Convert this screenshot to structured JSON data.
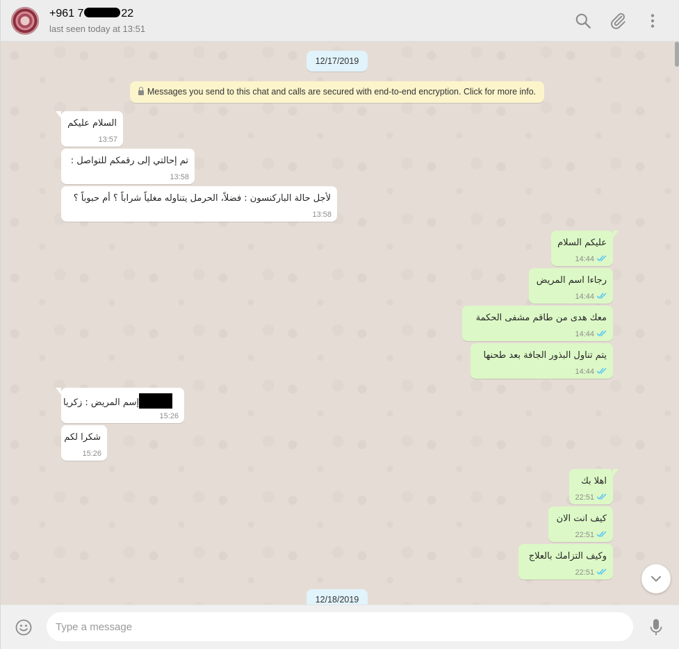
{
  "header": {
    "contact_prefix": "+961 7",
    "contact_suffix": "22",
    "last_seen": "last seen today at 13:51",
    "icons": [
      "search-icon",
      "attach-icon",
      "menu-icon"
    ]
  },
  "chat": {
    "date_1": "12/17/2019",
    "encryption_notice": "Messages you send to this chat and calls are secured with end-to-end encryption. Click for more info.",
    "messages": [
      {
        "dir": "in",
        "text": "السلام عليكم",
        "time": "13:57"
      },
      {
        "dir": "in",
        "text": "تم إحالتي إلى رقمكم للتواصل :",
        "time": "13:58"
      },
      {
        "dir": "in",
        "text": "لأجل حالة الباركنسون : فضلاً، الحرمل يتناوله مغلياً شراباً ؟ أم حبوباً ؟",
        "time": "13:58"
      },
      {
        "dir": "out",
        "text": "عليكم السلام",
        "time": "14:44"
      },
      {
        "dir": "out",
        "text": "رجاءا اسم المريض",
        "time": "14:44"
      },
      {
        "dir": "out",
        "text": "معك هدى من طاقم مشفى الحكمة",
        "time": "14:44"
      },
      {
        "dir": "out",
        "text": "يتم تناول البذور الجافة بعد طحنها",
        "time": "14:44"
      },
      {
        "dir": "in",
        "text": "إسم المريض : زكريا",
        "time": "15:26"
      },
      {
        "dir": "in",
        "text": "شكرا لكم",
        "time": "15:26"
      },
      {
        "dir": "out",
        "text": "اهلا بك",
        "time": "22:51"
      },
      {
        "dir": "out",
        "text": "كيف انت الان",
        "time": "22:51"
      },
      {
        "dir": "out",
        "text": "وكيف التزامك بالعلاج",
        "time": "22:51"
      }
    ],
    "date_2": "12/18/2019"
  },
  "composer": {
    "placeholder": "Type a message"
  },
  "colors": {
    "incoming_bubble": "#ffffff",
    "outgoing_bubble": "#dcf8c6",
    "chat_background": "#e5ddd5",
    "read_ticks": "#4fc3f7"
  }
}
